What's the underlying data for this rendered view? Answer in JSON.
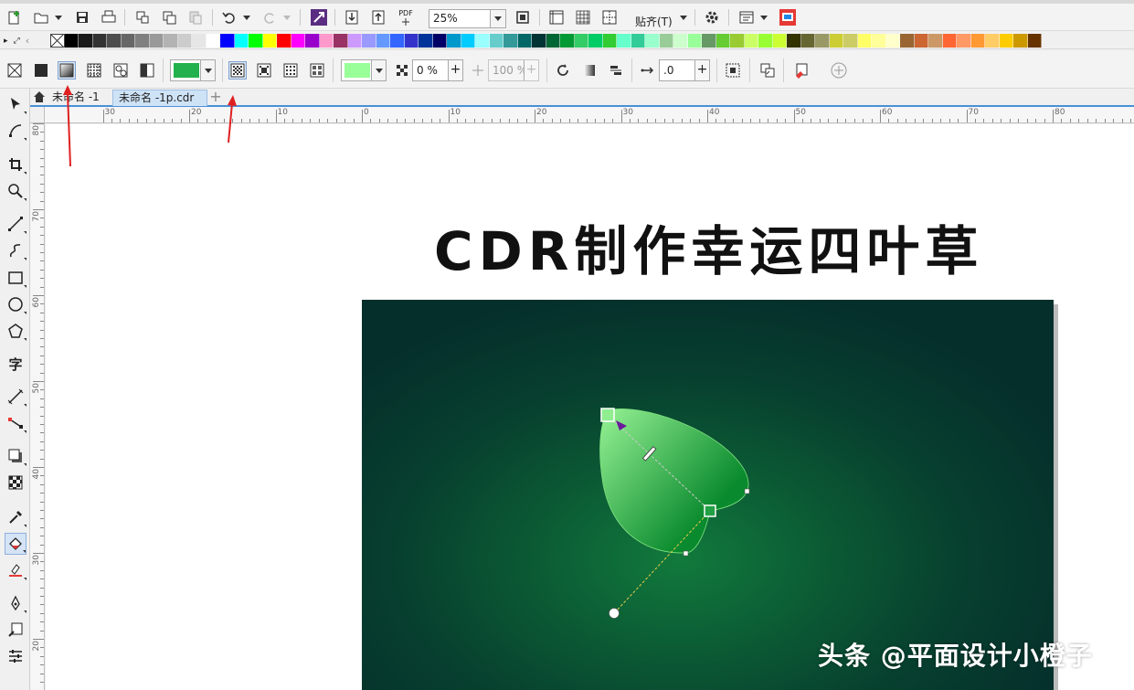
{
  "toolbar": {
    "zoom_value": "25%",
    "snap_label": "贴齐(T)",
    "pdf_label": "PDF"
  },
  "palette": {
    "colors": [
      "#000000",
      "#1a1a1a",
      "#333333",
      "#4d4d4d",
      "#666666",
      "#808080",
      "#999999",
      "#b3b3b3",
      "#cccccc",
      "#e6e6e6",
      "#ffffff",
      "#0000ff",
      "#00ffff",
      "#00ff00",
      "#ffff00",
      "#ff0000",
      "#ff00ff",
      "#9900cc",
      "#ff99cc",
      "#993366",
      "#cc99ff",
      "#9999ff",
      "#6699ff",
      "#3366ff",
      "#3333cc",
      "#003399",
      "#000066",
      "#0099cc",
      "#00ccff",
      "#99ffff",
      "#66cccc",
      "#339999",
      "#006666",
      "#003333",
      "#006633",
      "#009933",
      "#33cc66",
      "#00cc66",
      "#33cc33",
      "#66ffcc",
      "#33cc99",
      "#99ffcc",
      "#99cc99",
      "#ccffcc",
      "#99ff99",
      "#669966",
      "#66cc33",
      "#99cc33",
      "#ccff66",
      "#99ff33",
      "#ccff33",
      "#333300",
      "#666633",
      "#999966",
      "#cccc33",
      "#cccc66",
      "#ffff66",
      "#ffff99",
      "#ffffcc",
      "#996633",
      "#cc6633",
      "#cc9966",
      "#ff6633",
      "#ff9966",
      "#ff9933",
      "#ffcc66",
      "#ffcc00",
      "#cc9900",
      "#663300"
    ]
  },
  "property_bar": {
    "fill_color": "#22b14c",
    "fill_color_2": "#99ff99",
    "transparency_value": "0 %",
    "opacity_value": "100 %",
    "offset_value": ".0"
  },
  "tabs": [
    {
      "label": "未命名 -1"
    },
    {
      "label": "未命名 -1p.cdr"
    }
  ],
  "rulers": {
    "h_labels": [
      "30",
      "20",
      "10",
      "0",
      "10",
      "20",
      "30",
      "40",
      "50",
      "60",
      "70",
      "80"
    ],
    "v_labels": [
      "80",
      "70",
      "60",
      "50",
      "40",
      "30",
      "20"
    ]
  },
  "canvas": {
    "headline": "CDR制作幸运四叶草",
    "artboard_bg_center": "#117a3c",
    "artboard_bg_edge": "#052f2b",
    "leaf_light": "#90ee90",
    "leaf_dark": "#0a8a2e",
    "watermark": "头条 @平面设计小橙子"
  },
  "colors": {
    "accent": "#4a90d9",
    "annotation_arrow": "#e02020"
  }
}
